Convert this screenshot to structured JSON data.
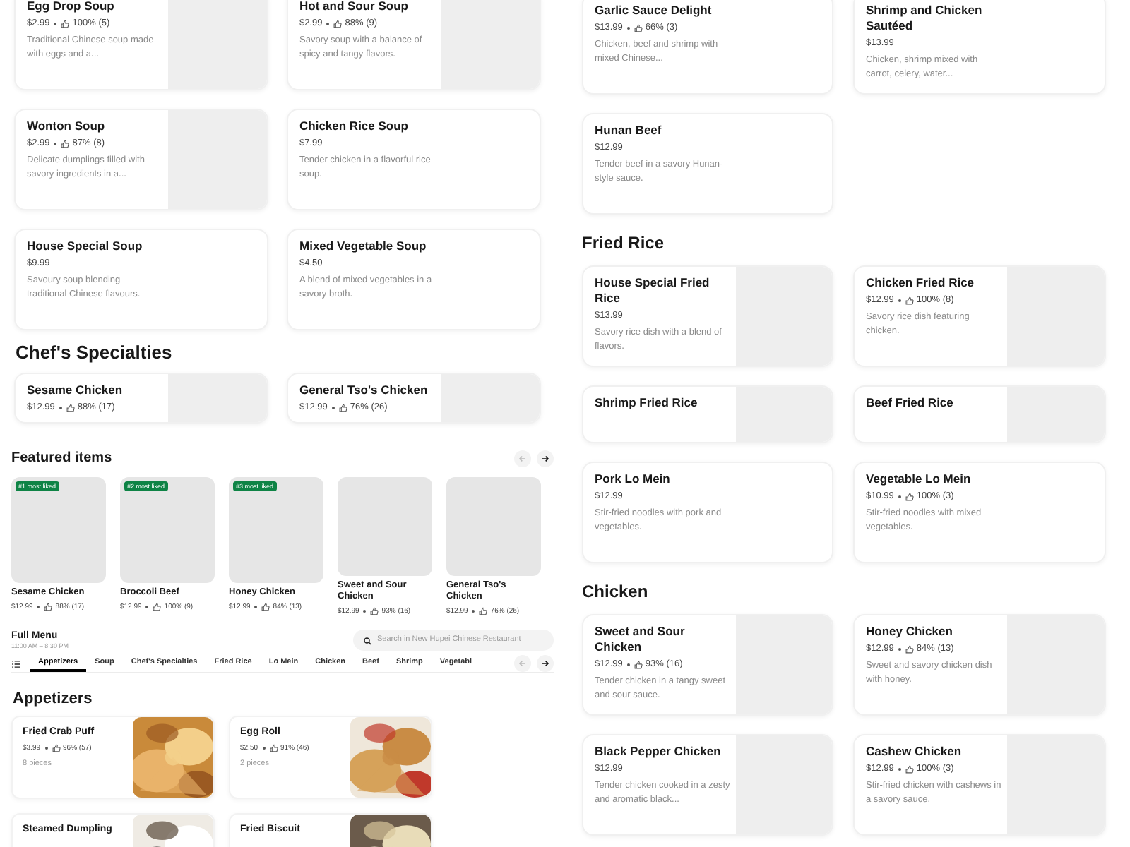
{
  "soup_items": [
    {
      "name": "Egg Drop Soup",
      "price": "$2.99",
      "rating": "100% (5)",
      "description": "Traditional Chinese soup made with eggs and a...",
      "kind": "placeholder"
    },
    {
      "name": "Hot and Sour Soup",
      "price": "$2.99",
      "rating": "88% (9)",
      "description": "Savory soup with a balance of spicy and tangy flavors.",
      "kind": "placeholder"
    },
    {
      "name": "Wonton Soup",
      "price": "$2.99",
      "rating": "87% (8)",
      "description": "Delicate dumplings filled with savory ingredients in a...",
      "kind": "placeholder"
    },
    {
      "name": "Chicken Rice Soup",
      "price": "$7.99",
      "description": "Tender chicken in a flavorful rice soup."
    },
    {
      "name": "House Special Soup",
      "price": "$9.99",
      "description": "Savoury soup blending traditional Chinese flavours."
    },
    {
      "name": "Mixed Vegetable Soup",
      "price": "$4.50",
      "description": "A blend of mixed vegetables in a savory broth."
    }
  ],
  "chefs_specialties": {
    "title": "Chef's Specialties",
    "items": [
      {
        "name": "Sesame Chicken",
        "price": "$12.99",
        "rating": "88% (17)",
        "kind": "placeholder"
      },
      {
        "name": "General Tso's Chicken",
        "price": "$12.99",
        "rating": "76% (26)",
        "kind": "placeholder"
      }
    ]
  },
  "featured": {
    "title": "Featured items",
    "prev_disabled": true,
    "next_disabled": false,
    "items": [
      {
        "badge": "#1 most liked",
        "name": "Sesame Chicken",
        "price": "$12.99",
        "rating": "88% (17)"
      },
      {
        "badge": "#2 most liked",
        "name": "Broccoli Beef",
        "price": "$12.99",
        "rating": "100% (9)"
      },
      {
        "badge": "#3 most liked",
        "name": "Honey Chicken",
        "price": "$12.99",
        "rating": "84% (13)"
      },
      {
        "name": "Sweet and Sour Chicken",
        "price": "$12.99",
        "rating": "93% (16)"
      },
      {
        "name": "General Tso's Chicken",
        "price": "$12.99",
        "rating": "76% (26)"
      }
    ]
  },
  "full_menu": {
    "title": "Full Menu",
    "hours": "11:00 AM – 8:30 PM",
    "search_placeholder": "Search in New Hupei Chinese Restaurant",
    "prev_disabled": true,
    "next_disabled": false,
    "categories": [
      {
        "label": "Appetizers",
        "selected": true
      },
      {
        "label": "Soup",
        "selected": false
      },
      {
        "label": "Chef's Specialties",
        "selected": false
      },
      {
        "label": "Fried Rice",
        "selected": false
      },
      {
        "label": "Lo Mein",
        "selected": false
      },
      {
        "label": "Chicken",
        "selected": false
      },
      {
        "label": "Beef",
        "selected": false
      },
      {
        "label": "Shrimp",
        "selected": false
      },
      {
        "label": "Vegetabl",
        "selected": false
      }
    ]
  },
  "appetizers": {
    "title": "Appetizers",
    "items": [
      {
        "name": "Fried Crab Puff",
        "price": "$3.99",
        "rating": "96% (57)",
        "description": "8 pieces",
        "kind": "picture"
      },
      {
        "name": "Egg Roll",
        "price": "$2.50",
        "rating": "91% (46)",
        "description": "2 pieces",
        "kind": "picture"
      },
      {
        "name": "Steamed Dumpling",
        "kind": "picture"
      },
      {
        "name": "Fried Biscuit",
        "kind": "picture"
      }
    ]
  },
  "right_sections": [
    {
      "items": [
        {
          "name": "Garlic Sauce Delight",
          "price": "$13.99",
          "rating": "66% (3)",
          "description": "Chicken, beef and shrimp with mixed Chinese..."
        },
        {
          "name": "Shrimp and Chicken Sautéed",
          "price": "$13.99",
          "description": "Chicken, shrimp mixed with carrot, celery, water..."
        },
        {
          "name": "Hunan Beef",
          "price": "$12.99",
          "description": "Tender beef in a savory Hunan-style sauce."
        }
      ]
    },
    {
      "title": "Fried Rice",
      "items": [
        {
          "name": "House Special Fried Rice",
          "price": "$13.99",
          "description": "Savory rice dish with a blend of flavors.",
          "kind": "placeholder"
        },
        {
          "name": "Chicken Fried Rice",
          "price": "$12.99",
          "rating": "100% (8)",
          "description": "Savory rice dish featuring chicken.",
          "kind": "placeholder"
        },
        {
          "name": "Shrimp Fried Rice",
          "kind": "placeholder"
        },
        {
          "name": "Beef Fried Rice",
          "kind": "placeholder"
        },
        {
          "name": "Pork Lo Mein",
          "price": "$12.99",
          "description": "Stir-fried noodles with pork and vegetables."
        },
        {
          "name": "Vegetable Lo Mein",
          "price": "$10.99",
          "rating": "100% (3)",
          "description": "Stir-fried noodles with mixed vegetables."
        }
      ]
    },
    {
      "title": "Chicken",
      "items": [
        {
          "name": "Sweet and Sour Chicken",
          "price": "$12.99",
          "rating": "93% (16)",
          "description": "Tender chicken in a tangy sweet and sour sauce.",
          "kind": "placeholder"
        },
        {
          "name": "Honey Chicken",
          "price": "$12.99",
          "rating": "84% (13)",
          "description": "Sweet and savory chicken dish with honey.",
          "kind": "placeholder"
        },
        {
          "name": "Black Pepper Chicken",
          "price": "$12.99",
          "description": "Tender chicken cooked in a zesty and aromatic black...",
          "kind": "placeholder"
        },
        {
          "name": "Cashew Chicken",
          "price": "$12.99",
          "rating": "100% (3)",
          "description": "Stir-fried chicken with cashews in a savory sauce.",
          "kind": "placeholder"
        }
      ]
    }
  ]
}
